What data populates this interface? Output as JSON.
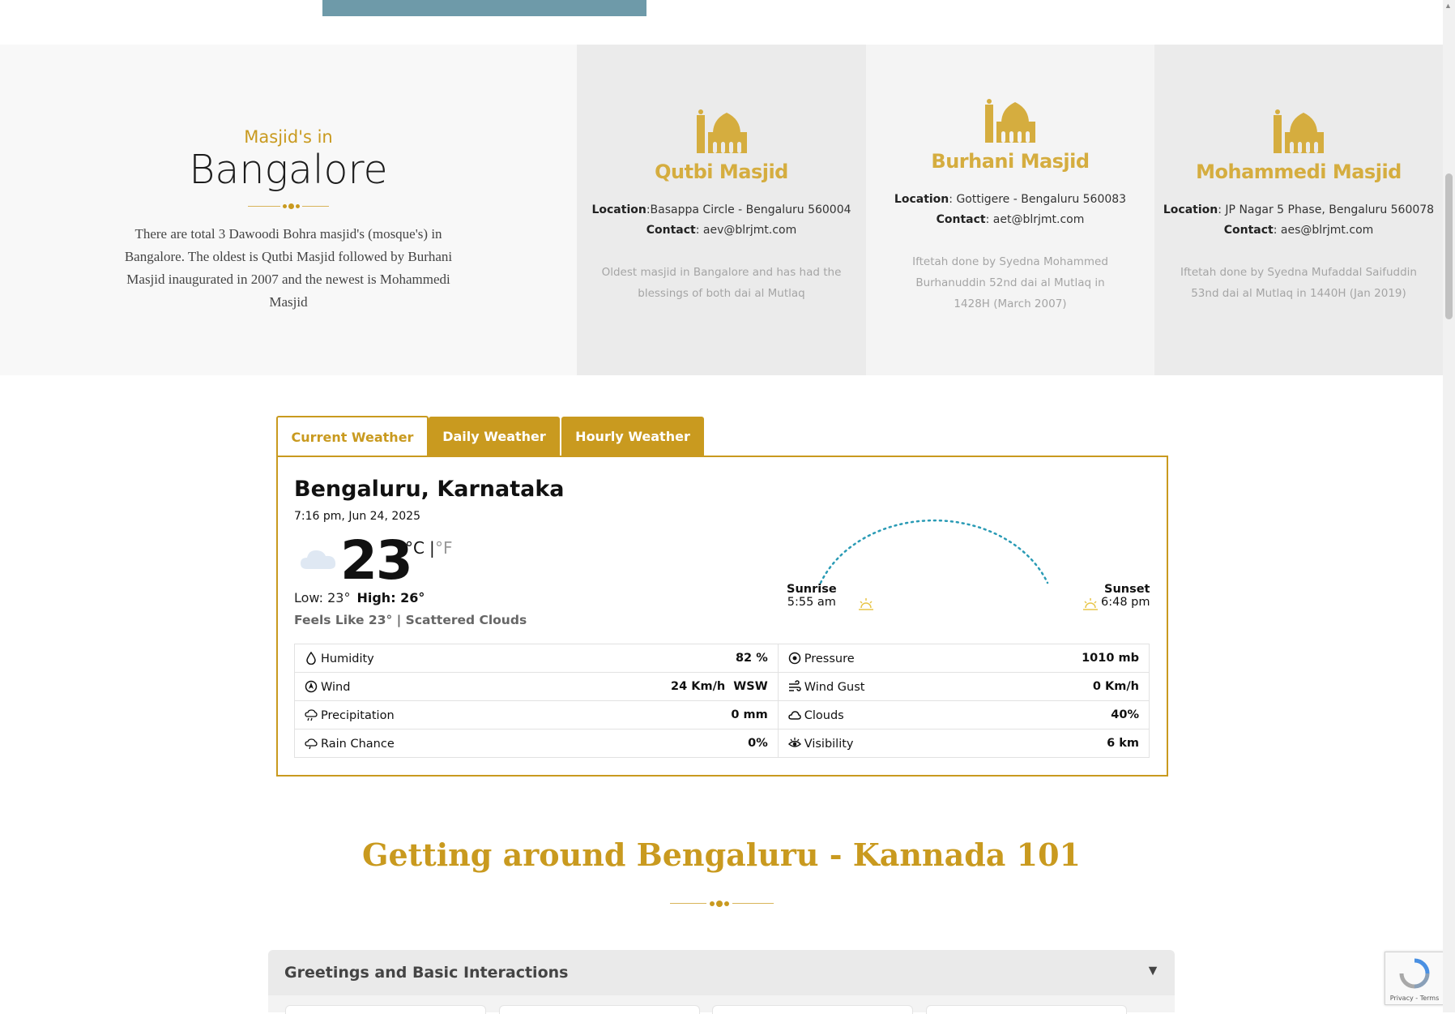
{
  "intro": {
    "subtitle": "Masjid's in",
    "title": "Bangalore",
    "paragraph": "There are total 3 Dawoodi Bohra masjid's (mosque's) in Bangalore. The oldest is Qutbi Masjid followed by Burhani Masjid inaugurated in 2007 and the newest is Mohammedi Masjid"
  },
  "masjids": [
    {
      "name": "Qutbi Masjid",
      "location_label": "Location",
      "location": ":Basappa Circle - Bengaluru 560004",
      "contact_label": "Contact",
      "contact": ": aev@blrjmt.com",
      "note": "Oldest masjid in Bangalore and has had the blessings of both dai al Mutlaq"
    },
    {
      "name": "Burhani Masjid",
      "location_label": "Location",
      "location": ": Gottigere - Bengaluru 560083",
      "contact_label": "Contact",
      "contact": ": aet@blrjmt.com",
      "note": "Iftetah done by Syedna Mohammed Burhanuddin 52nd dai al Mutlaq in 1428H (March 2007)"
    },
    {
      "name": "Mohammedi Masjid",
      "location_label": "Location",
      "location": ": JP Nagar 5 Phase, Bengaluru 560078",
      "contact_label": "Contact",
      "contact": ": aes@blrjmt.com",
      "note": "Iftetah done by Syedna Mufaddal Saifuddin 53nd dai al Mutlaq in 1440H (Jan 2019)"
    }
  ],
  "weather": {
    "tabs": [
      "Current Weather",
      "Daily Weather",
      "Hourly Weather"
    ],
    "city": "Bengaluru, Karnataka",
    "datetime": "7:16 pm, Jun 24, 2025",
    "temp": "23",
    "unit_c": "°C",
    "unit_sep": "|",
    "unit_f": "°F",
    "low": "Low: 23°",
    "high": "High: 26°",
    "feels": "Feels Like 23° | Scattered Clouds",
    "sunrise_label": "Sunrise",
    "sunrise": "5:55 am",
    "sunset_label": "Sunset",
    "sunset": "6:48 pm",
    "rows": [
      {
        "k1": "Humidity",
        "v1": "82 %",
        "k2": "Pressure",
        "v2": "1010 mb"
      },
      {
        "k1": "Wind",
        "v1": "24 Km/h  WSW",
        "k2": "Wind Gust",
        "v2": "0 Km/h"
      },
      {
        "k1": "Precipitation",
        "v1": "0 mm",
        "k2": "Clouds",
        "v2": "40%"
      },
      {
        "k1": "Rain Chance",
        "v1": "0%",
        "k2": "Visibility",
        "v2": "6 km"
      }
    ],
    "icons": [
      "humidity-icon",
      "pressure-icon",
      "wind-icon",
      "wind-gust-icon",
      "precipitation-icon",
      "clouds-icon",
      "rain-chance-icon",
      "visibility-icon"
    ]
  },
  "kannada": {
    "title": "Getting around Bengaluru - Kannada 101",
    "accordion_label": "Greetings and Basic Interactions",
    "accordion_arrow": "▼"
  },
  "recaptcha": {
    "text": "Privacy - Terms"
  },
  "colors": {
    "accent": "#c99a1f",
    "mosque_icon": "#d5ad3f",
    "top_banner": "#6e9aa9",
    "arc": "#2a9bb5"
  }
}
